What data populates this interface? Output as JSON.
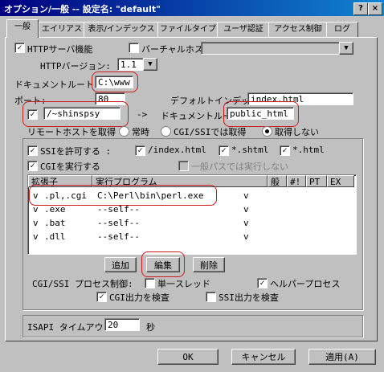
{
  "window": {
    "title": "オプション/一般 -- 設定名: \"default\"",
    "help_btn": "?",
    "close_btn": "×"
  },
  "tabs": [
    "一般",
    "エイリアス",
    "表示/インデックス",
    "ファイルタイプ",
    "ユーザ認証",
    "アクセス制御",
    "ログ"
  ],
  "http": {
    "server_label": "HTTPサーバ機能",
    "server_checked": true,
    "virtual_label": "バーチャルホスト",
    "virtual_checked": false,
    "version_label": "HTTPバージョン:",
    "version_value": "1.1",
    "docroot_label": "ドキュメントルート:",
    "docroot_value": "C:\\www",
    "port_label": "ポート:",
    "port_value": "80",
    "default_index_label": "デフォルトインデックス:",
    "default_index_value": "index.html",
    "user_dir_checked": true,
    "user_dir_value": "/~shinspsy",
    "arrow": "->",
    "user_docroot_label": "ドキュメントルート:",
    "user_docroot_value": "public_html",
    "remote_host_label": "リモートホストを取得",
    "remote_host_options": [
      "常時",
      "CGI/SSIでは取得",
      "取得しない"
    ],
    "remote_host_selected": 2
  },
  "cgi": {
    "ssi_label": "SSIを許可する :",
    "ssi_checked": true,
    "ssi_exts": [
      {
        "label": "/index.html",
        "checked": true
      },
      {
        "label": "*.shtml",
        "checked": true
      },
      {
        "label": "*.html",
        "checked": true
      }
    ],
    "cgi_label": "CGIを実行する",
    "cgi_checked": true,
    "general_path_label": "一般パスでは実行しない",
    "general_path_checked": false,
    "columns": [
      "拡張子",
      "実行プログラム",
      "般",
      "#!",
      "PT",
      "EX"
    ],
    "rows": [
      {
        "mark": "v",
        "ext": ".pl,.cgi",
        "program": "C:\\Perl\\bin\\perl.exe",
        "general": "v"
      },
      {
        "mark": "v",
        "ext": ".exe",
        "program": "--self--",
        "general": "v"
      },
      {
        "mark": "v",
        "ext": ".bat",
        "program": "--self--",
        "general": "v"
      },
      {
        "mark": "v",
        "ext": ".dll",
        "program": "--self--",
        "general": "v"
      }
    ],
    "add_btn": "追加",
    "edit_btn": "編集",
    "delete_btn": "削除",
    "process_label": "CGI/SSI プロセス制御:",
    "single_thread_label": "単一スレッド",
    "single_thread_checked": false,
    "helper_label": "ヘルパープロセス",
    "helper_checked": true,
    "check_cgi_label": "CGI出力を検査",
    "check_cgi_checked": true,
    "check_ssi_label": "SSI出力を検査",
    "check_ssi_checked": false
  },
  "isapi": {
    "timeout_label": "ISAPI タイムアウト",
    "timeout_value": "20",
    "unit": "秒"
  },
  "footer": {
    "ok": "OK",
    "cancel": "キャンセル",
    "apply": "適用(A)"
  },
  "colors": {
    "titlebar": "#000080",
    "annotation": "#d01818"
  }
}
